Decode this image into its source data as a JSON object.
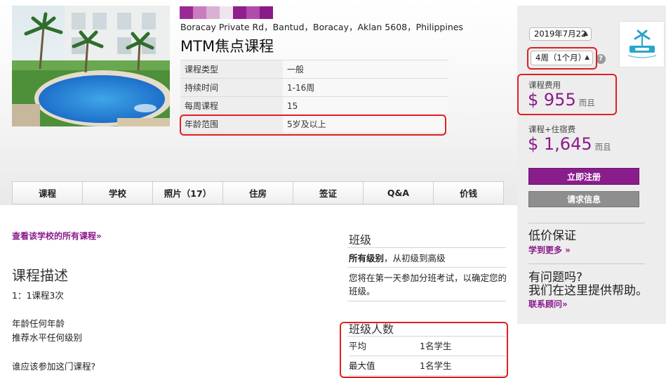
{
  "header": {
    "swatches": [
      "#9a2a93",
      "#c97cc0",
      "#d9b2d3",
      "#f0e4ee",
      "#8f1f8c",
      "#b04ca9",
      "#8a1a87"
    ],
    "address": "Boracay Private Rd，Bantud，Boracay，Aklan 5608，Philippines",
    "course_title": "MTM焦点课程",
    "info_rows": [
      {
        "label": "课程类型",
        "value": "一般"
      },
      {
        "label": "持续时间",
        "value": "1-16周"
      },
      {
        "label": "每周课程",
        "value": "15"
      },
      {
        "label": "年龄范围",
        "value": "5岁及以上"
      }
    ]
  },
  "tabs": [
    "课程",
    "学校",
    "照片（17）",
    "住房",
    "签证",
    "Q&A",
    "价钱"
  ],
  "sidebar": {
    "date_value": "2019年7月22",
    "duration_value": "4周（1个月）",
    "help_glyph": "?",
    "course_fee_label": "课程费用",
    "course_fee_amount": "$ 955",
    "course_fee_suffix": "而且",
    "combo_label": "课程+住宿费",
    "combo_amount": "$ 1,645",
    "combo_suffix": "而且",
    "register_button": "立即注册",
    "request_button": "请求信息",
    "price_guarantee_heading": "低价保证",
    "learn_more_link": "学到更多 »",
    "questions_heading_1": "有问题吗?",
    "questions_heading_2": "我们在这里提供帮助。",
    "contact_link": "联系顾问»"
  },
  "main": {
    "all_courses_link": "查看该学校的所有课程»",
    "description_heading": "课程描述",
    "description_lines": [
      "1：1课程3次",
      "年龄任何年龄",
      "推荐水平任何级别",
      "谁应该参加这门课程?"
    ]
  },
  "class_info": {
    "heading": "班级",
    "levels_bold": "所有级别",
    "levels_rest": "，从初级到高级",
    "placement_text": "您将在第一天参加分班考试，以确定您的班级。",
    "size_heading": "班级人数",
    "size_rows": [
      {
        "label": "平均",
        "value": "1名学生"
      },
      {
        "label": "最大值",
        "value": "1名学生"
      }
    ]
  },
  "colors": {
    "accent": "#8b1a8b",
    "highlight": "#e02020",
    "sidebar_bg": "#ededed"
  }
}
